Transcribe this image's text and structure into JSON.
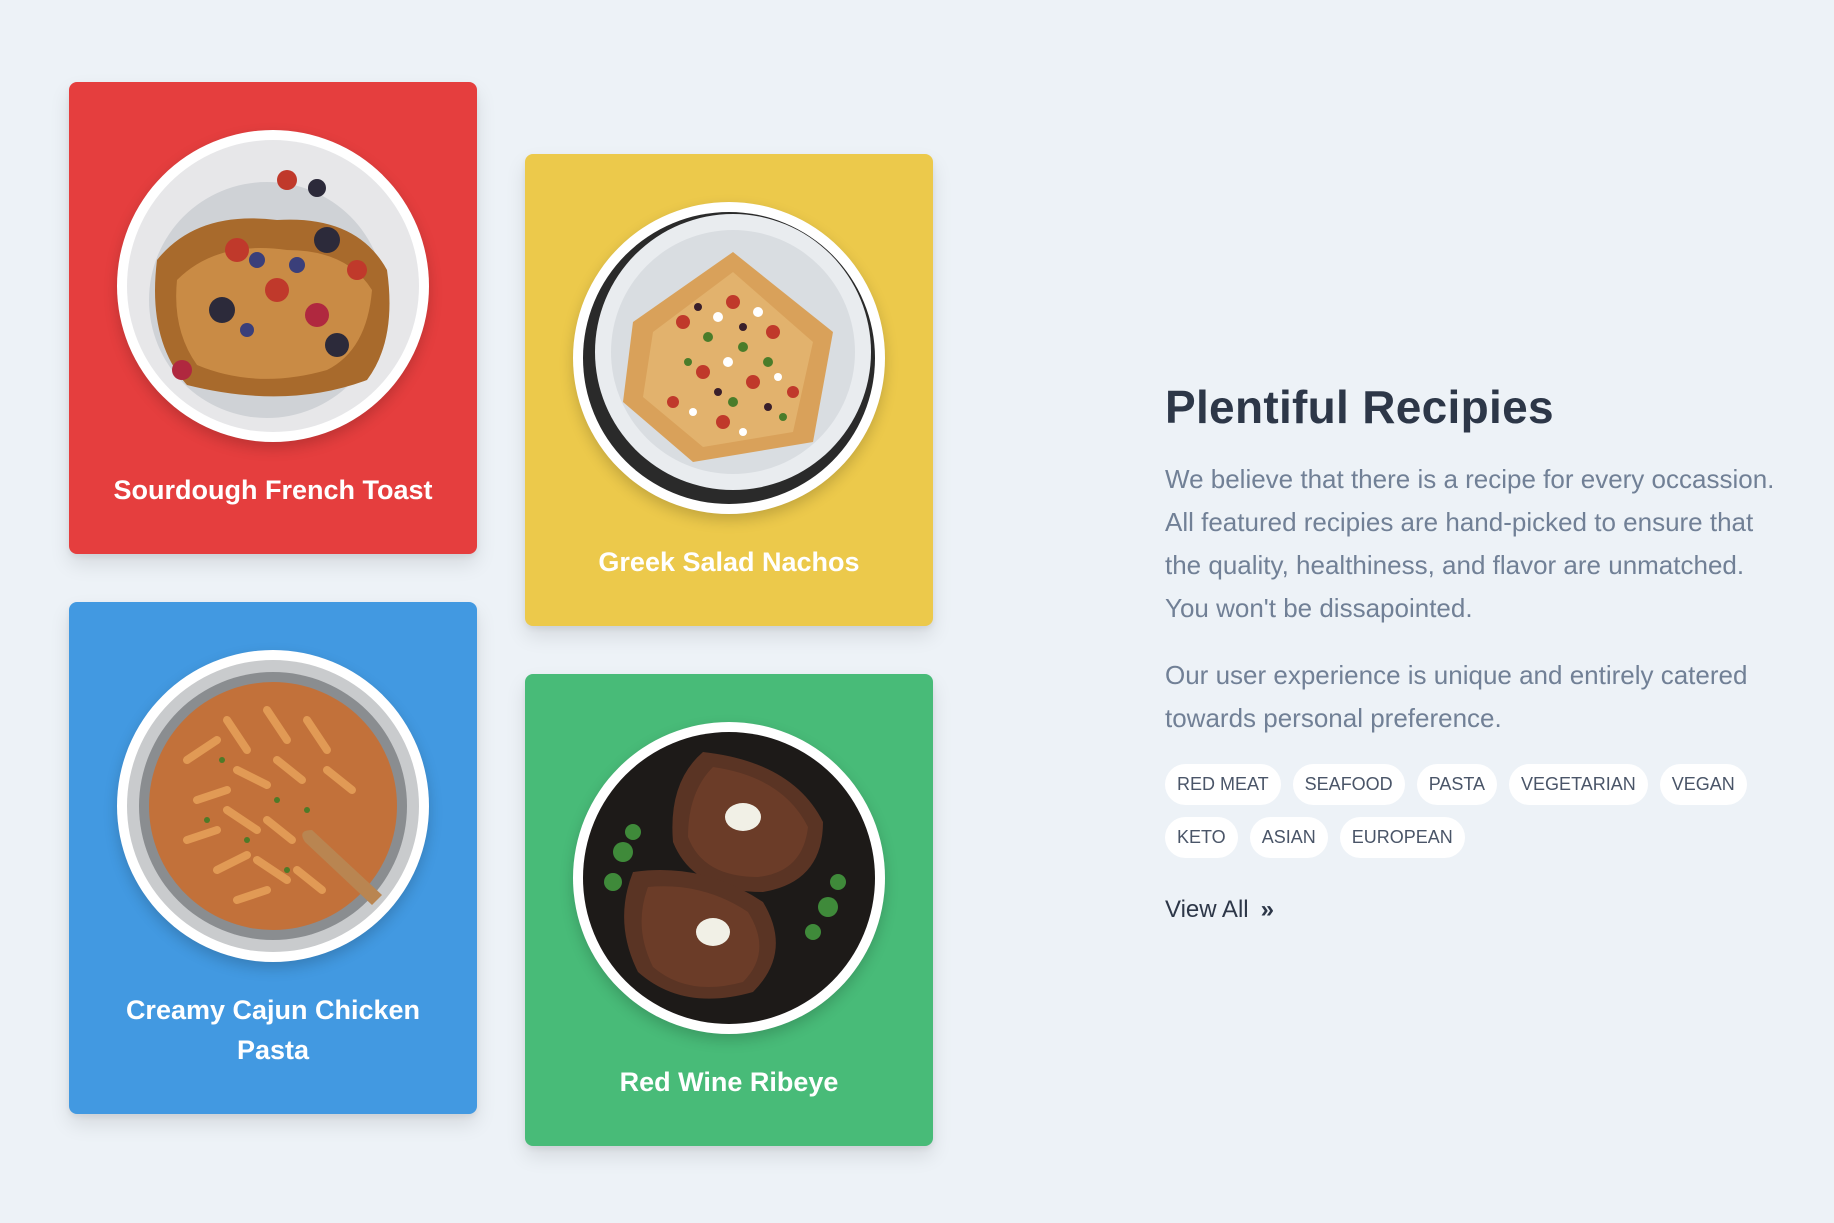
{
  "cards": [
    {
      "title": "Sourdough French Toast",
      "color": "#e53e3e",
      "image": "french-toast-photo"
    },
    {
      "title": "Greek Salad Nachos",
      "color": "#ecc94b",
      "image": "nachos-photo"
    },
    {
      "title": "Creamy Cajun Chicken Pasta",
      "color": "#4299e1",
      "image": "pasta-photo"
    },
    {
      "title": "Red Wine Ribeye",
      "color": "#48bb78",
      "image": "ribeye-photo"
    }
  ],
  "info": {
    "heading": "Plentiful Recipies",
    "paragraph1": "We believe that there is a recipe for every occassion. All featured recipies are hand-picked to ensure that the quality, healthiness, and flavor are unmatched. You won't be dissapointed.",
    "paragraph2": "Our user experience is unique and entirely catered towards personal preference.",
    "tags": [
      "RED MEAT",
      "SEAFOOD",
      "PASTA",
      "VEGETARIAN",
      "VEGAN",
      "KETO",
      "ASIAN",
      "EUROPEAN"
    ],
    "view_all_label": "View All",
    "view_all_icon": "double-chevron-right-icon"
  },
  "colors": {
    "background": "#edf2f7",
    "heading": "#2d3748",
    "body_text": "#718096"
  }
}
